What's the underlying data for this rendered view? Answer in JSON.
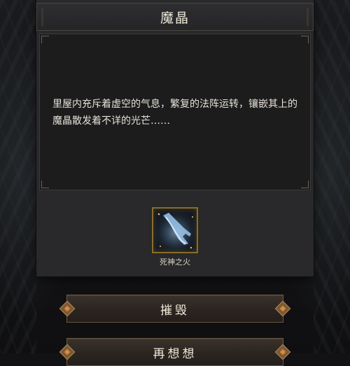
{
  "dialog": {
    "title": "魔晶",
    "story": "里屋内充斥着虚空的气息，繁复的法阵运转，镶嵌其上的魔晶散发着不详的光芒……",
    "item": {
      "name": "死神之火",
      "icon": "spectral-hand-icon"
    }
  },
  "actions": {
    "destroy_label": "摧毁",
    "reconsider_label": "再想想"
  },
  "colors": {
    "accent_gold": "#8a6d2c",
    "ornament_orange": "#d98a3c",
    "panel_bg": "#29292b"
  }
}
